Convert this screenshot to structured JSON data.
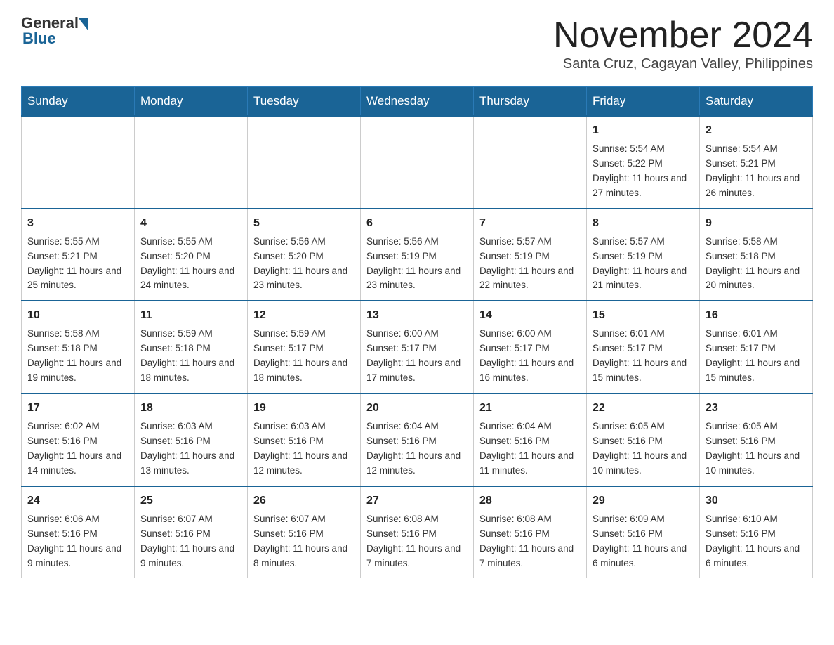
{
  "header": {
    "logo_general": "General",
    "logo_blue": "Blue",
    "month_title": "November 2024",
    "subtitle": "Santa Cruz, Cagayan Valley, Philippines"
  },
  "days_of_week": [
    "Sunday",
    "Monday",
    "Tuesday",
    "Wednesday",
    "Thursday",
    "Friday",
    "Saturday"
  ],
  "weeks": [
    [
      {
        "day": "",
        "info": ""
      },
      {
        "day": "",
        "info": ""
      },
      {
        "day": "",
        "info": ""
      },
      {
        "day": "",
        "info": ""
      },
      {
        "day": "",
        "info": ""
      },
      {
        "day": "1",
        "info": "Sunrise: 5:54 AM\nSunset: 5:22 PM\nDaylight: 11 hours\nand 27 minutes."
      },
      {
        "day": "2",
        "info": "Sunrise: 5:54 AM\nSunset: 5:21 PM\nDaylight: 11 hours\nand 26 minutes."
      }
    ],
    [
      {
        "day": "3",
        "info": "Sunrise: 5:55 AM\nSunset: 5:21 PM\nDaylight: 11 hours\nand 25 minutes."
      },
      {
        "day": "4",
        "info": "Sunrise: 5:55 AM\nSunset: 5:20 PM\nDaylight: 11 hours\nand 24 minutes."
      },
      {
        "day": "5",
        "info": "Sunrise: 5:56 AM\nSunset: 5:20 PM\nDaylight: 11 hours\nand 23 minutes."
      },
      {
        "day": "6",
        "info": "Sunrise: 5:56 AM\nSunset: 5:19 PM\nDaylight: 11 hours\nand 23 minutes."
      },
      {
        "day": "7",
        "info": "Sunrise: 5:57 AM\nSunset: 5:19 PM\nDaylight: 11 hours\nand 22 minutes."
      },
      {
        "day": "8",
        "info": "Sunrise: 5:57 AM\nSunset: 5:19 PM\nDaylight: 11 hours\nand 21 minutes."
      },
      {
        "day": "9",
        "info": "Sunrise: 5:58 AM\nSunset: 5:18 PM\nDaylight: 11 hours\nand 20 minutes."
      }
    ],
    [
      {
        "day": "10",
        "info": "Sunrise: 5:58 AM\nSunset: 5:18 PM\nDaylight: 11 hours\nand 19 minutes."
      },
      {
        "day": "11",
        "info": "Sunrise: 5:59 AM\nSunset: 5:18 PM\nDaylight: 11 hours\nand 18 minutes."
      },
      {
        "day": "12",
        "info": "Sunrise: 5:59 AM\nSunset: 5:17 PM\nDaylight: 11 hours\nand 18 minutes."
      },
      {
        "day": "13",
        "info": "Sunrise: 6:00 AM\nSunset: 5:17 PM\nDaylight: 11 hours\nand 17 minutes."
      },
      {
        "day": "14",
        "info": "Sunrise: 6:00 AM\nSunset: 5:17 PM\nDaylight: 11 hours\nand 16 minutes."
      },
      {
        "day": "15",
        "info": "Sunrise: 6:01 AM\nSunset: 5:17 PM\nDaylight: 11 hours\nand 15 minutes."
      },
      {
        "day": "16",
        "info": "Sunrise: 6:01 AM\nSunset: 5:17 PM\nDaylight: 11 hours\nand 15 minutes."
      }
    ],
    [
      {
        "day": "17",
        "info": "Sunrise: 6:02 AM\nSunset: 5:16 PM\nDaylight: 11 hours\nand 14 minutes."
      },
      {
        "day": "18",
        "info": "Sunrise: 6:03 AM\nSunset: 5:16 PM\nDaylight: 11 hours\nand 13 minutes."
      },
      {
        "day": "19",
        "info": "Sunrise: 6:03 AM\nSunset: 5:16 PM\nDaylight: 11 hours\nand 12 minutes."
      },
      {
        "day": "20",
        "info": "Sunrise: 6:04 AM\nSunset: 5:16 PM\nDaylight: 11 hours\nand 12 minutes."
      },
      {
        "day": "21",
        "info": "Sunrise: 6:04 AM\nSunset: 5:16 PM\nDaylight: 11 hours\nand 11 minutes."
      },
      {
        "day": "22",
        "info": "Sunrise: 6:05 AM\nSunset: 5:16 PM\nDaylight: 11 hours\nand 10 minutes."
      },
      {
        "day": "23",
        "info": "Sunrise: 6:05 AM\nSunset: 5:16 PM\nDaylight: 11 hours\nand 10 minutes."
      }
    ],
    [
      {
        "day": "24",
        "info": "Sunrise: 6:06 AM\nSunset: 5:16 PM\nDaylight: 11 hours\nand 9 minutes."
      },
      {
        "day": "25",
        "info": "Sunrise: 6:07 AM\nSunset: 5:16 PM\nDaylight: 11 hours\nand 9 minutes."
      },
      {
        "day": "26",
        "info": "Sunrise: 6:07 AM\nSunset: 5:16 PM\nDaylight: 11 hours\nand 8 minutes."
      },
      {
        "day": "27",
        "info": "Sunrise: 6:08 AM\nSunset: 5:16 PM\nDaylight: 11 hours\nand 7 minutes."
      },
      {
        "day": "28",
        "info": "Sunrise: 6:08 AM\nSunset: 5:16 PM\nDaylight: 11 hours\nand 7 minutes."
      },
      {
        "day": "29",
        "info": "Sunrise: 6:09 AM\nSunset: 5:16 PM\nDaylight: 11 hours\nand 6 minutes."
      },
      {
        "day": "30",
        "info": "Sunrise: 6:10 AM\nSunset: 5:16 PM\nDaylight: 11 hours\nand 6 minutes."
      }
    ]
  ]
}
